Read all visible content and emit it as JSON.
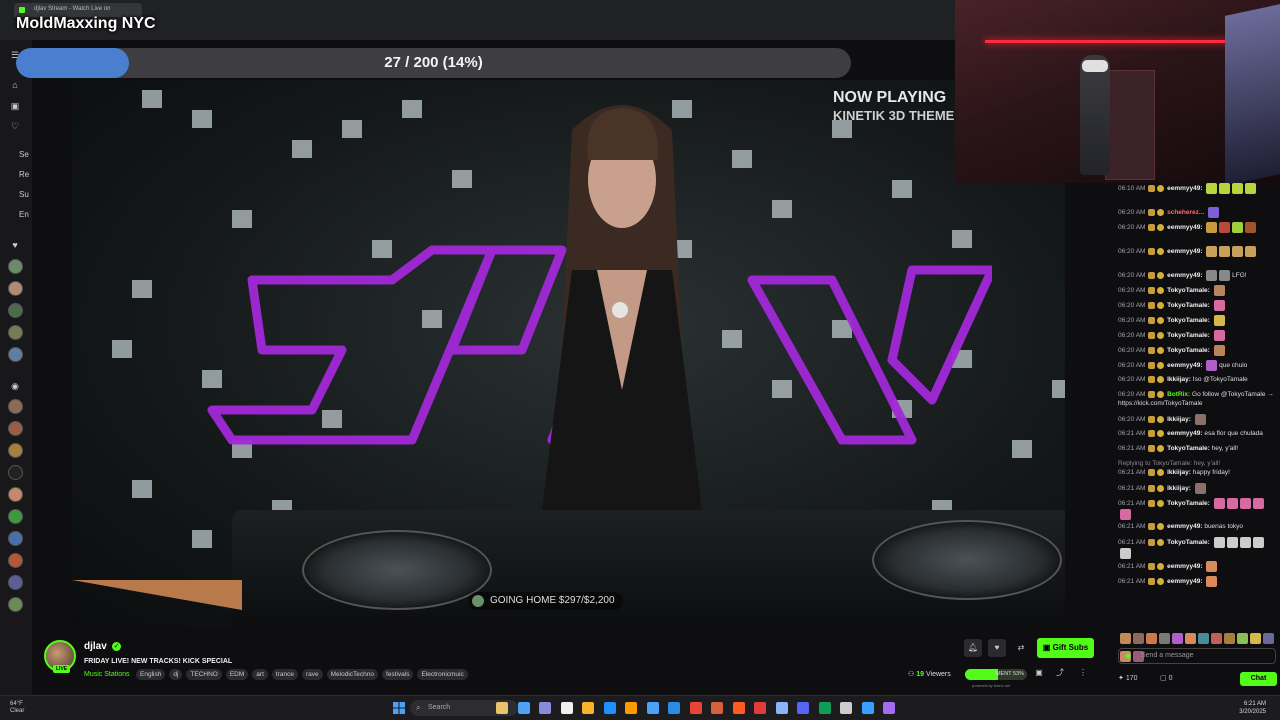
{
  "browser": {
    "tab_title": "djlav Stream - Watch Live on"
  },
  "overlay": {
    "title": "MoldMaxxing NYC",
    "progress_text": "27 / 200 (14%)",
    "progress_fraction": 0.135
  },
  "sidebar": {
    "labels": [
      "Se",
      "Re",
      "Su",
      "En"
    ]
  },
  "video": {
    "now_playing": "NOW PLAYING",
    "theme": "KINETIK 3D THEME",
    "goal": "GOING HOME  $297/$2,200",
    "logo_letters": "djlav"
  },
  "channel": {
    "name": "djlav",
    "live_label": "LIVE",
    "title": "FRIDAY LIVE! NEW TRACKS! KICK SPECIAL",
    "category": "Music Stations",
    "tags": [
      "English",
      "dj",
      "TECHNO",
      "EDM",
      "art",
      "trance",
      "rave",
      "MelodicTechno",
      "festivals",
      "Electronicmuic"
    ],
    "viewers_count": "19",
    "viewers_label": "Viewers",
    "gift_subs": "Gift Subs",
    "hype_text": "MENT 53%",
    "hype_fraction": 0.53,
    "hype_caption": "powered by botrix.net"
  },
  "chat": {
    "messages": [
      {
        "time": "06:10 AM",
        "user": "eemmyy49:",
        "text": "",
        "color": "#f0f0f0",
        "emotes": [
          "#b7d43c",
          "#b7d43c",
          "#b7d43c",
          "#b7d43c"
        ]
      },
      {
        "time": "06:20 AM",
        "user": "scheherez...",
        "text": "",
        "color": "#ff6b6b",
        "emotes": [
          "#7d5fd6"
        ]
      },
      {
        "time": "06:20 AM",
        "user": "eemmyy49:",
        "text": "",
        "color": "#f0f0f0",
        "emotes": [
          "#c79a3e",
          "#b94a3a",
          "#9fcf3a",
          "#a0552b"
        ]
      },
      {
        "time": "06:20 AM",
        "user": "eemmyy49:",
        "text": "",
        "color": "#f0f0f0",
        "emotes": [
          "#c7a15a",
          "#c7a15a",
          "#c7a15a",
          "#c7a15a"
        ]
      },
      {
        "time": "06:20 AM",
        "user": "eemmyy49:",
        "text": "LFG!",
        "color": "#f0f0f0",
        "emotes": [
          "#888",
          "#888"
        ]
      },
      {
        "time": "06:20 AM",
        "user": "TokyoTamale:",
        "text": "",
        "color": "#f0f0f0",
        "emotes": [
          "#b9835c"
        ]
      },
      {
        "time": "06:20 AM",
        "user": "TokyoTamale:",
        "text": "",
        "color": "#f0f0f0",
        "emotes": [
          "#d86aa2"
        ]
      },
      {
        "time": "06:20 AM",
        "user": "TokyoTamale:",
        "text": "",
        "color": "#f0f0f0",
        "emotes": [
          "#d5b84a"
        ]
      },
      {
        "time": "06:20 AM",
        "user": "TokyoTamale:",
        "text": "",
        "color": "#f0f0f0",
        "emotes": [
          "#d86aa2"
        ]
      },
      {
        "time": "06:20 AM",
        "user": "TokyoTamale:",
        "text": "",
        "color": "#f0f0f0",
        "emotes": [
          "#b9835c"
        ]
      },
      {
        "time": "06:20 AM",
        "user": "eemmyy49:",
        "text": "que chulo",
        "color": "#f0f0f0",
        "emotes": [
          "#b05fc9"
        ]
      },
      {
        "time": "06:20 AM",
        "user": "lkkiijay:",
        "text": "Iso @TokyoTamale",
        "color": "#f0f0f0",
        "emotes": []
      },
      {
        "time": "06:20 AM",
        "user": "BotRix:",
        "text": "Go follow @TokyoTamale → https://kick.com/TokyoTamale",
        "color": "#53fc18",
        "emotes": []
      },
      {
        "time": "06:20 AM",
        "user": "lkkiijay:",
        "text": "",
        "color": "#f0f0f0",
        "emotes": [
          "#8a6f6a"
        ]
      },
      {
        "time": "06:21 AM",
        "user": "eemmyy49:",
        "text": "esa flor que chulada",
        "color": "#f0f0f0",
        "emotes": []
      },
      {
        "time": "06:21 AM",
        "user": "TokyoTamale:",
        "text": "hey, y'all!",
        "color": "#f0f0f0",
        "emotes": []
      },
      {
        "time": "06:21 AM",
        "user": "lkkiijay:",
        "text": "happy friday!",
        "color": "#f0f0f0",
        "emotes": [],
        "reply": "Replying to TokyoTamale: hey, y'all!"
      },
      {
        "time": "06:21 AM",
        "user": "lkkiijay:",
        "text": "",
        "color": "#f0f0f0",
        "emotes": [
          "#8a6f6a"
        ]
      },
      {
        "time": "06:21 AM",
        "user": "TokyoTamale:",
        "text": "",
        "color": "#f0f0f0",
        "emotes": [
          "#d86aa2",
          "#d86aa2",
          "#d86aa2",
          "#d86aa2",
          "#d86aa2"
        ]
      },
      {
        "time": "06:21 AM",
        "user": "eemmyy49:",
        "text": "buenas tokyo",
        "color": "#f0f0f0",
        "emotes": []
      },
      {
        "time": "06:21 AM",
        "user": "TokyoTamale:",
        "text": "",
        "color": "#f0f0f0",
        "emotes": [
          "#ccc",
          "#ccc",
          "#ccc",
          "#ccc",
          "#ccc"
        ]
      },
      {
        "time": "06:21 AM",
        "user": "eemmyy49:",
        "text": "",
        "color": "#f0f0f0",
        "emotes": [
          "#d88a5a"
        ]
      },
      {
        "time": "06:21 AM",
        "user": "eemmyy49:",
        "text": "",
        "color": "#f0f0f0",
        "emotes": [
          "#d88a5a"
        ]
      }
    ],
    "input_placeholder": "Send a message",
    "points": "170",
    "count_zero": "0",
    "chat_button": "Chat"
  },
  "taskbar": {
    "temp": "64°F",
    "condition": "Clear",
    "search_placeholder": "Search",
    "time": "6:21 AM",
    "date": "3/20/2025"
  }
}
